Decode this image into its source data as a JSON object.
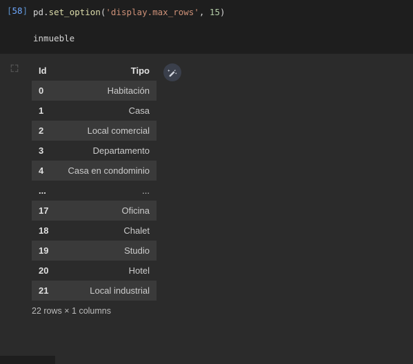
{
  "cell": {
    "exec_count": "58",
    "code_tokens": {
      "obj1": "pd",
      "dot1": ".",
      "fn": "set_option",
      "paren_open": "(",
      "str": "'display.max_rows'",
      "comma": ", ",
      "num": "15",
      "paren_close": ")"
    },
    "code_line2": "inmueble"
  },
  "output": {
    "table": {
      "index_name": "Id",
      "columns": [
        "Tipo"
      ],
      "rows": [
        {
          "idx": "0",
          "vals": [
            "Habitación"
          ]
        },
        {
          "idx": "1",
          "vals": [
            "Casa"
          ]
        },
        {
          "idx": "2",
          "vals": [
            "Local comercial"
          ]
        },
        {
          "idx": "3",
          "vals": [
            "Departamento"
          ]
        },
        {
          "idx": "4",
          "vals": [
            "Casa en condominio"
          ]
        },
        {
          "idx": "...",
          "vals": [
            "..."
          ]
        },
        {
          "idx": "17",
          "vals": [
            "Oficina"
          ]
        },
        {
          "idx": "18",
          "vals": [
            "Chalet"
          ]
        },
        {
          "idx": "19",
          "vals": [
            "Studio"
          ]
        },
        {
          "idx": "20",
          "vals": [
            "Hotel"
          ]
        },
        {
          "idx": "21",
          "vals": [
            "Local industrial"
          ]
        }
      ]
    },
    "footer": "22 rows × 1 columns"
  },
  "icons": {
    "suggest": "magic-wand-icon",
    "out": "output-expand-icon"
  }
}
